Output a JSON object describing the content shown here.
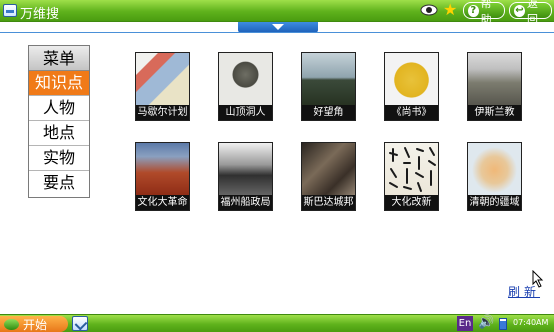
{
  "window": {
    "title": "万维搜"
  },
  "toolbar": {
    "help_label": "帮助",
    "back_label": "返回"
  },
  "menu": {
    "header": "菜单",
    "items": [
      {
        "label": "知识点",
        "active": true
      },
      {
        "label": "人物",
        "active": false
      },
      {
        "label": "地点",
        "active": false
      },
      {
        "label": "实物",
        "active": false
      },
      {
        "label": "要点",
        "active": false
      }
    ]
  },
  "grid": {
    "items": [
      {
        "caption": "马歇尔计划",
        "image": "europe-map-poster"
      },
      {
        "caption": "山顶洞人",
        "image": "bust-statue"
      },
      {
        "caption": "好望角",
        "image": "coastal-cape"
      },
      {
        "caption": "《尚书》",
        "image": "golden-book-cover"
      },
      {
        "caption": "伊斯兰教",
        "image": "city-skyline"
      },
      {
        "caption": "文化大革命",
        "image": "crowd-rally"
      },
      {
        "caption": "福州船政局",
        "image": "old-shipyard"
      },
      {
        "caption": "斯巴达城邦",
        "image": "ancient-ruins"
      },
      {
        "caption": "大化改新",
        "image": "calligraphy-scroll"
      },
      {
        "caption": "清朝的疆域",
        "image": "qing-map"
      }
    ]
  },
  "refresh_label": "刷新",
  "taskbar": {
    "start_label": "开始",
    "ime_label": "En",
    "clock": "07:40AM"
  },
  "colors": {
    "title_bar": "#5fb21c",
    "menu_active": "#f07a18",
    "link": "#1a3fb0"
  }
}
